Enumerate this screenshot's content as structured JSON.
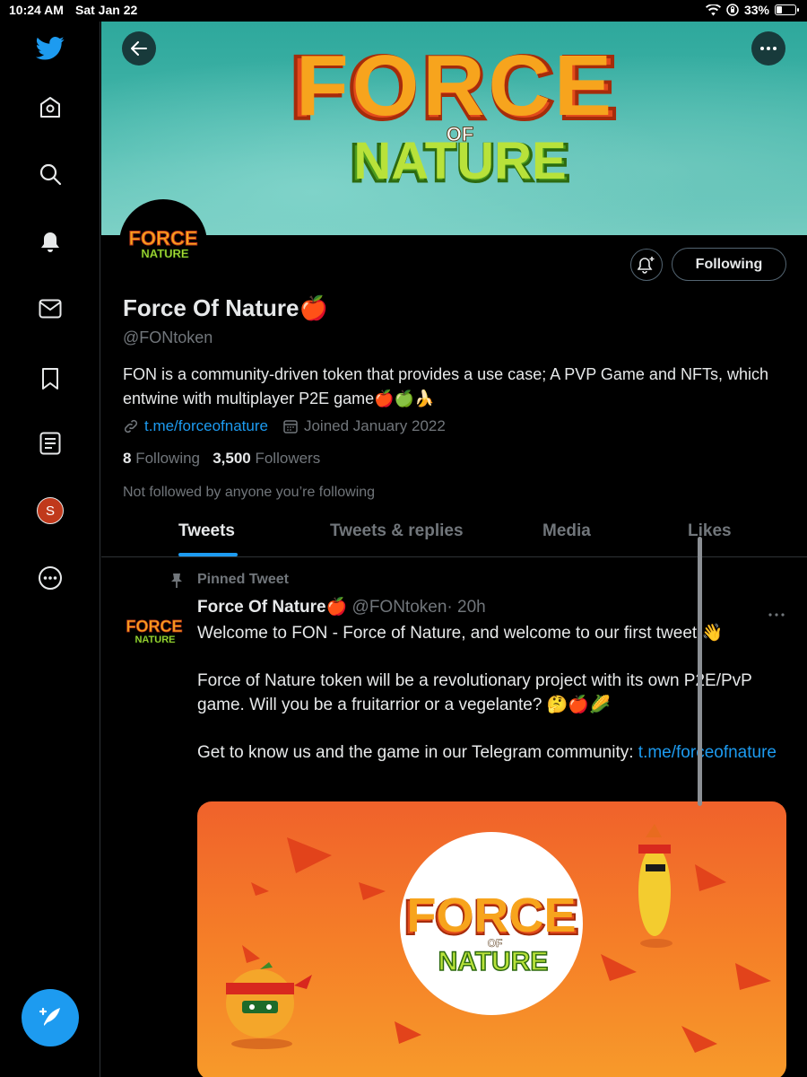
{
  "status_bar": {
    "time": "10:24 AM",
    "date": "Sat Jan 22",
    "battery": "33%",
    "battery_level": 0.33
  },
  "sidebar": {
    "items": [
      {
        "icon": "twitter-logo-icon"
      },
      {
        "icon": "home-icon"
      },
      {
        "icon": "search-icon"
      },
      {
        "icon": "bell-icon"
      },
      {
        "icon": "mail-icon"
      },
      {
        "icon": "bookmark-icon"
      },
      {
        "icon": "lists-icon"
      },
      {
        "icon": "avatar",
        "initial": "S"
      },
      {
        "icon": "more-icon"
      }
    ],
    "compose": {
      "icon": "compose-feather-icon"
    }
  },
  "profile": {
    "name": "Force Of Nature",
    "name_emoji": "🍎",
    "handle": "@FONtoken",
    "bio": "FON is a community-driven token that provides a use case; A PVP Game and NFTs, which entwine with multiplayer P2E game🍎🍏🍌",
    "link": "t.me/forceofnature",
    "joined": "Joined January 2022",
    "following_count": "8",
    "following_label": "Following",
    "followers_count": "3,500",
    "followers_label": "Followers",
    "not_followed": "Not followed by anyone you’re following",
    "follow_button": "Following",
    "banner_logo": {
      "line1": "FORCE",
      "of": "OF",
      "line2": "NATURE"
    }
  },
  "tabs": [
    {
      "label": "Tweets",
      "active": true
    },
    {
      "label": "Tweets & replies",
      "active": false
    },
    {
      "label": "Media",
      "active": false
    },
    {
      "label": "Likes",
      "active": false
    }
  ],
  "tweet": {
    "pinned_label": "Pinned Tweet",
    "author": "Force Of Nature🍎",
    "handle": "@FONtoken",
    "time": "· 20h",
    "para1": "Welcome to FON - Force of Nature, and welcome to our first tweet!👋",
    "para2": "Force of Nature token will be a revolutionary project with its own P2E/PvP game. Will you be a fruitarrior or a vegelante? 🤔🍎🌽",
    "para3": "Get to know us and the game in our Telegram community: ",
    "para3_link": "t.me/forceofnature",
    "media_logo": {
      "line1": "FORCE",
      "of": "OF",
      "line2": "NATURE"
    }
  },
  "colors": {
    "accent": "#1d9bf0",
    "background": "#000000",
    "secondary_text": "#71767b",
    "border": "#2f3336"
  }
}
